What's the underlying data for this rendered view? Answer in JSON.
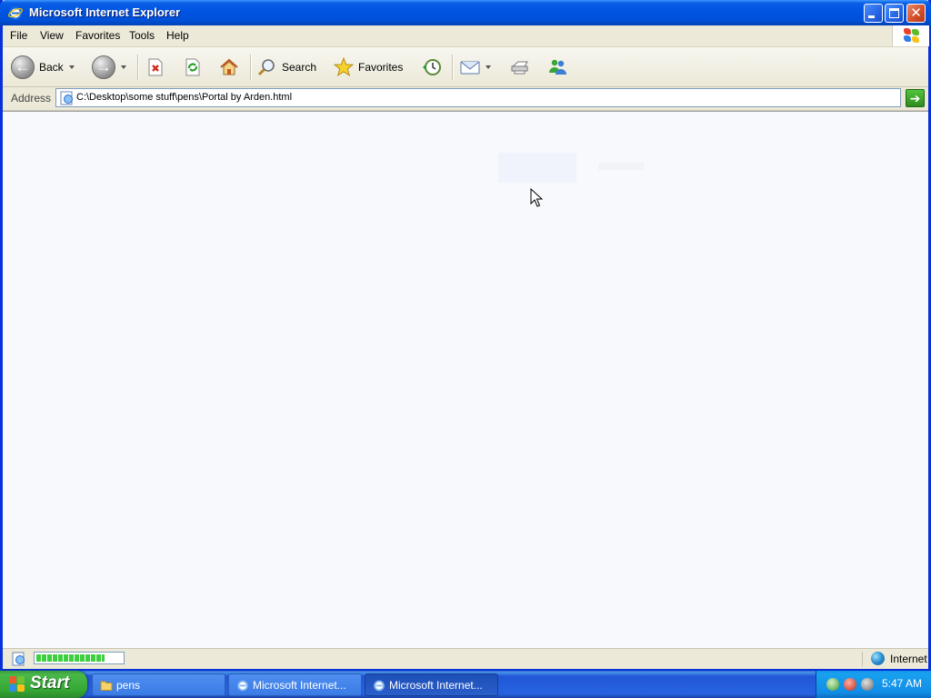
{
  "window": {
    "title": "Microsoft Internet Explorer"
  },
  "menu": {
    "items": [
      "File",
      "View",
      "Favorites",
      "Tools",
      "Help"
    ]
  },
  "toolbar": {
    "back_label": "Back",
    "search_label": "Search",
    "favorites_label": "Favorites"
  },
  "address": {
    "label": "Address",
    "url": "C:\\Desktop\\some stuff\\pens\\Portal by Arden.html"
  },
  "status": {
    "progress_percent": 80,
    "zone": "Internet"
  },
  "taskbar": {
    "start_label": "Start",
    "tasks": [
      {
        "label": "pens",
        "icon": "folder-icon",
        "active": false
      },
      {
        "label": "Microsoft Internet...",
        "icon": "ie-icon",
        "active": false
      },
      {
        "label": "Microsoft Internet...",
        "icon": "ie-icon",
        "active": true
      }
    ],
    "clock": "5:47 AM"
  },
  "colors": {
    "titlebar": "#0054e3",
    "taskbar": "#245edb",
    "start": "#3c9b3c",
    "content_bg": "#f8f9fd"
  }
}
